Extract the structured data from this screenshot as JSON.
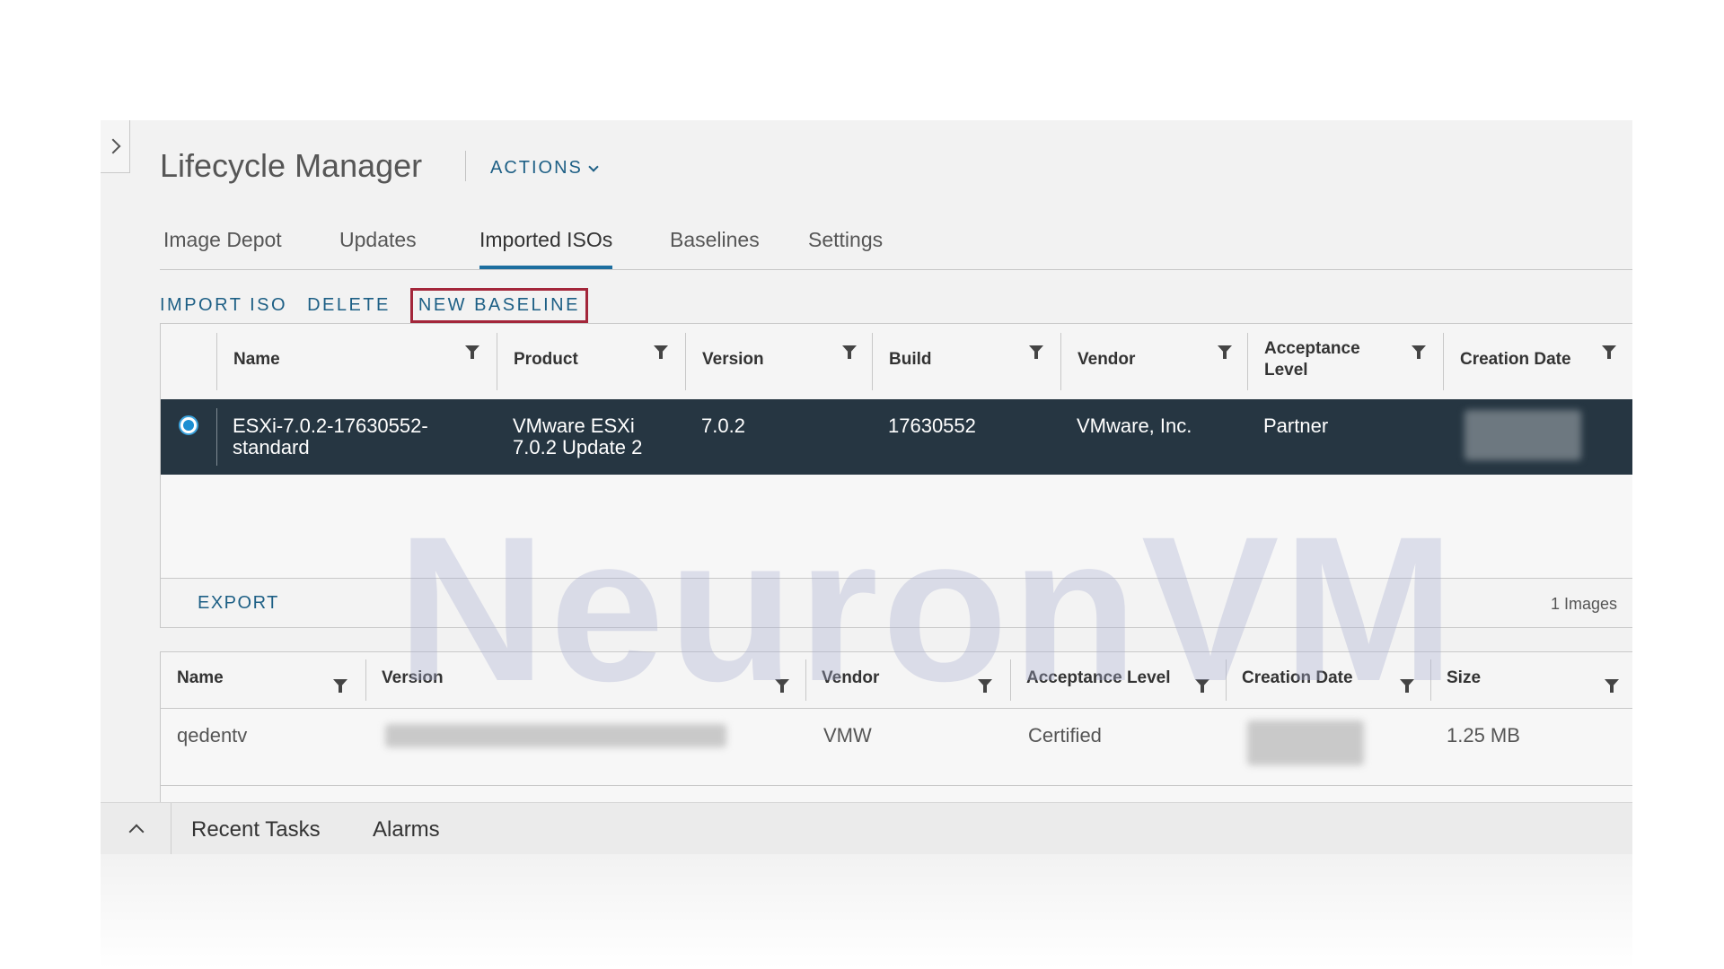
{
  "app": {
    "title": "Lifecycle Manager",
    "actions_label": "ACTIONS"
  },
  "tabs": [
    {
      "label": "Image Depot"
    },
    {
      "label": "Updates"
    },
    {
      "label": "Imported ISOs",
      "active": true
    },
    {
      "label": "Baselines"
    },
    {
      "label": "Settings"
    }
  ],
  "toolbar": {
    "import_iso": "IMPORT ISO",
    "delete": "DELETE",
    "new_baseline": "NEW BASELINE"
  },
  "iso_table": {
    "headers": [
      "Name",
      "Product",
      "Version",
      "Build",
      "Vendor",
      "Acceptance Level",
      "Creation Date"
    ],
    "rows": [
      {
        "name_line1": "ESXi-7.0.2-17630552-",
        "name_line2": "standard",
        "product_line1": "VMware ESXi",
        "product_line2": "7.0.2 Update 2",
        "version": "7.0.2",
        "build": "17630552",
        "vendor": "VMware, Inc.",
        "acceptance_level": "Partner",
        "selected": true
      }
    ],
    "export_label": "EXPORT",
    "count_label": "1 Images"
  },
  "component_table": {
    "headers": [
      "Name",
      "Version",
      "Vendor",
      "Acceptance Level",
      "Creation Date",
      "Size"
    ],
    "rows": [
      {
        "name": "qedentv",
        "vendor": "VMW",
        "acceptance_level": "Certified",
        "size": "1.25 MB"
      }
    ]
  },
  "watermark": "NeuronVM",
  "bottom_panel": {
    "recent_tasks": "Recent Tasks",
    "alarms": "Alarms"
  },
  "colors": {
    "accent": "#1d5f85",
    "selected_row": "#263642",
    "highlight_border": "#a3263a"
  },
  "icons": [
    "chevron-right-icon",
    "chevron-down-icon",
    "filter-icon",
    "radio-selected-icon",
    "chevron-up-icon"
  ]
}
